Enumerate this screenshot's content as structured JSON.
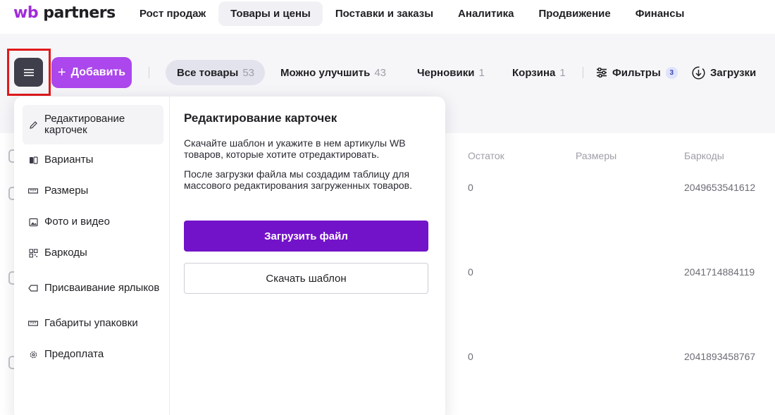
{
  "logo": {
    "wb": "wb",
    "partners": "partners"
  },
  "nav": {
    "items": [
      {
        "label": "Рост продаж"
      },
      {
        "label": "Товары и цены"
      },
      {
        "label": "Поставки и заказы"
      },
      {
        "label": "Аналитика"
      },
      {
        "label": "Продвижение"
      },
      {
        "label": "Финансы"
      }
    ],
    "active": "Товары и цены"
  },
  "toolbar": {
    "menu_icon": "hamburger-icon",
    "add_icon": "plus-icon",
    "add_label": "Добавить",
    "tabs": [
      {
        "label": "Все товары",
        "count": "53"
      },
      {
        "label": "Можно улучшить",
        "count": "43"
      },
      {
        "label": "Черновики",
        "count": "1"
      },
      {
        "label": "Корзина",
        "count": "1"
      }
    ],
    "filters_icon": "sliders-icon",
    "filters_label": "Фильтры",
    "filters_badge": "3",
    "downloads_icon": "download-circle-icon",
    "downloads_label": "Загрузки"
  },
  "table": {
    "headers": [
      "Остаток",
      "Размеры",
      "Баркоды"
    ],
    "rows": [
      {
        "stock": "0",
        "barcode": "2049653541612"
      },
      {
        "stock": "0",
        "barcode": "2041714884119"
      },
      {
        "stock": "0",
        "barcode": "2041893458767"
      }
    ]
  },
  "dropdown": {
    "menu": [
      {
        "label": "Редактирование карточек",
        "icon": "pencil-icon"
      },
      {
        "label": "Варианты",
        "icon": "variants-icon"
      },
      {
        "label": "Размеры",
        "icon": "ruler-icon"
      },
      {
        "label": "Фото и видео",
        "icon": "image-icon"
      },
      {
        "label": "Баркоды",
        "icon": "qr-code-icon"
      },
      {
        "label": "Присваивание ярлыков",
        "icon": "tag-icon"
      },
      {
        "label": "Габариты упаковки",
        "icon": "ruler-icon"
      },
      {
        "label": "Предоплата",
        "icon": "gear-icon"
      }
    ],
    "detail": {
      "title": "Редактирование карточек",
      "paragraph1": "Скачайте шаблон и укажите в нем артикулы WB товаров, которые хотите отредактировать.",
      "paragraph2": "После загрузки файла мы создадим таблицу для массового редактирования загруженных товаров.",
      "upload_label": "Загрузить файл",
      "template_label": "Скачать шаблон"
    }
  },
  "colors": {
    "brand_purple": "#7313c9",
    "add_button": "#ab47ec",
    "menu_button": "#3f3f4c",
    "highlight": "#e0191b"
  }
}
